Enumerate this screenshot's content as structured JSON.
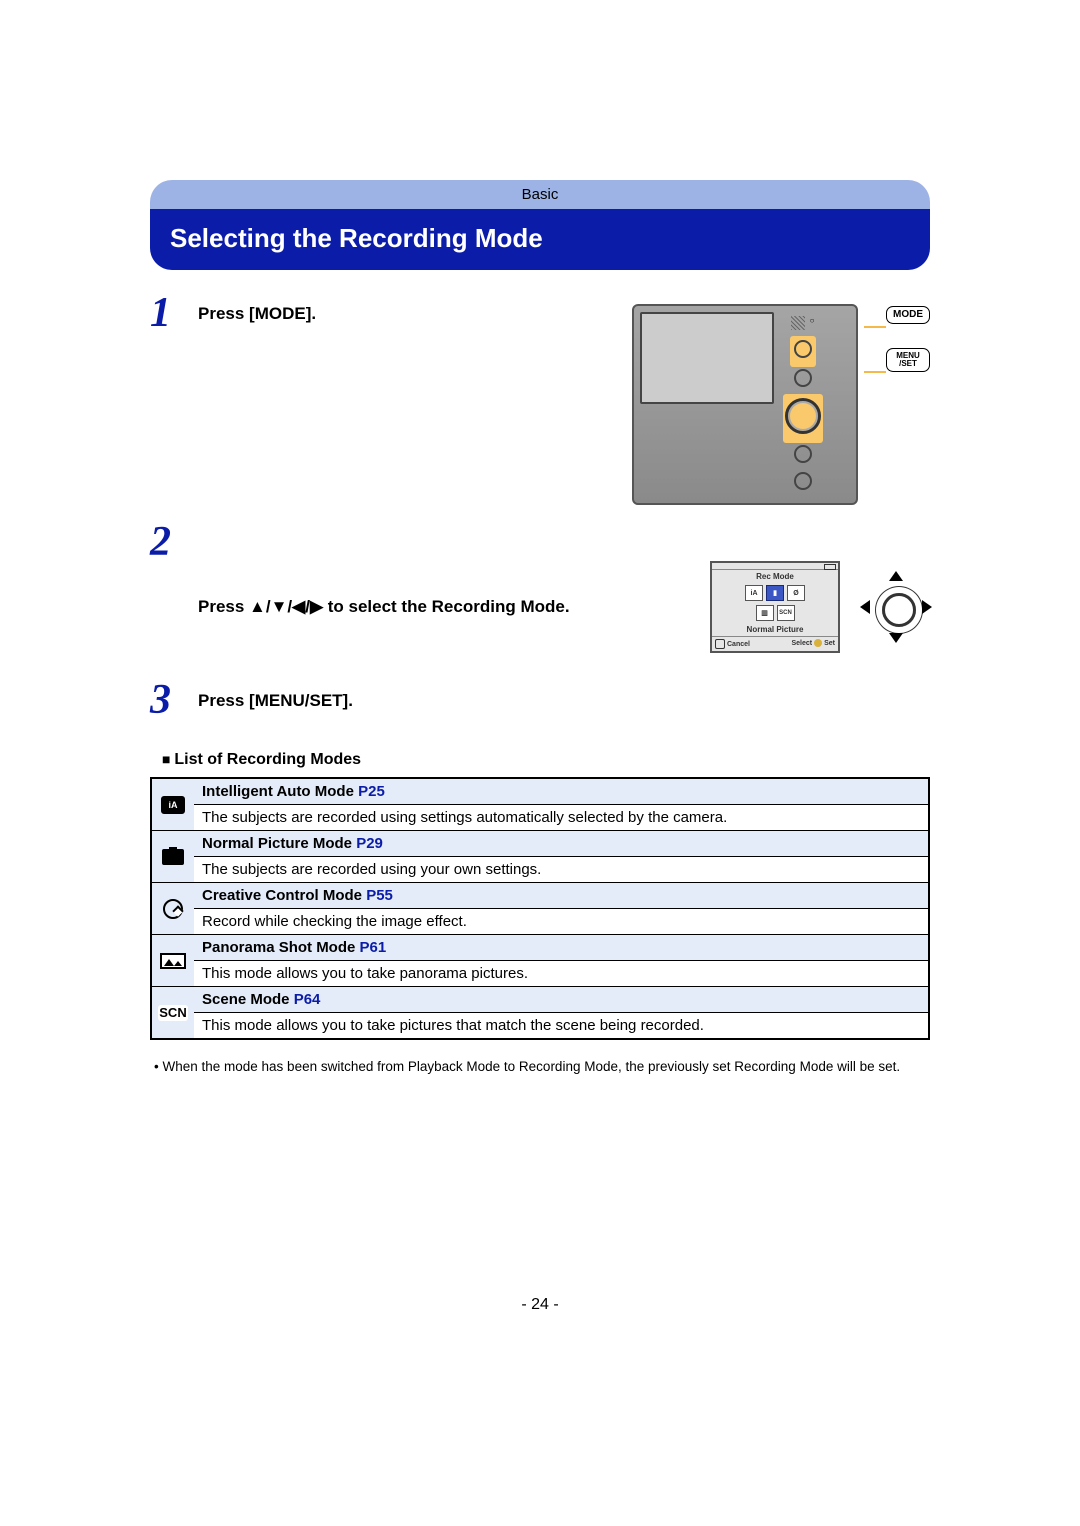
{
  "header": {
    "section": "Basic",
    "title": "Selecting the Recording Mode"
  },
  "steps": {
    "s1": {
      "num": "1",
      "text": "Press [MODE]."
    },
    "s2": {
      "num": "2",
      "prefix": "Press ",
      "arrows": "▲/▼/◀/▶",
      "suffix": " to select the Recording Mode."
    },
    "s3": {
      "num": "3",
      "text": "Press [MENU/SET]."
    }
  },
  "camera_labels": {
    "mode": "MODE",
    "menuset_top": "MENU",
    "menuset_bot": "/SET"
  },
  "mode_screen": {
    "title": "Rec Mode",
    "selected_label": "Normal Picture",
    "cancel": "Cancel",
    "select": "Select",
    "set": "Set",
    "icons_row1": [
      "iA",
      "▮",
      "Ø"
    ],
    "icons_row2": [
      "▥",
      "SCN"
    ]
  },
  "list_heading": "List of Recording Modes",
  "modes": [
    {
      "icon": "ia",
      "name": "Intelligent Auto Mode",
      "page": "P25",
      "desc": "The subjects are recorded using settings automatically selected by the camera."
    },
    {
      "icon": "camera",
      "name": "Normal Picture Mode",
      "page": "P29",
      "desc": "The subjects are recorded using your own settings."
    },
    {
      "icon": "palette",
      "name": "Creative Control Mode",
      "page": "P55",
      "desc": "Record while checking the image effect."
    },
    {
      "icon": "pano",
      "name": "Panorama Shot Mode",
      "page": "P61",
      "desc": "This mode allows you to take panorama pictures."
    },
    {
      "icon": "scn",
      "name": "Scene Mode",
      "page": "P64",
      "desc": "This mode allows you to take pictures that match the scene being recorded."
    }
  ],
  "note": "When the mode has been switched from Playback Mode to Recording Mode, the previously set Recording Mode will be set.",
  "footer": "- 24 -"
}
